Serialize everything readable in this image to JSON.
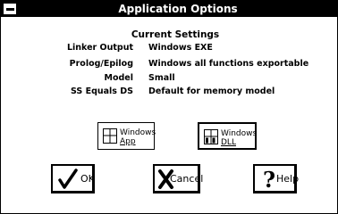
{
  "window": {
    "title": "Application Options"
  },
  "current_settings": {
    "heading": "Current Settings",
    "rows": [
      {
        "label": "Linker Output",
        "value": "Windows EXE"
      },
      {
        "label": "Prolog/Epilog",
        "value": "Windows all functions exportable"
      },
      {
        "label": "Model",
        "value": "Small"
      },
      {
        "label": "SS Equals DS",
        "value": "Default for memory model"
      }
    ]
  },
  "options": {
    "windows_app": {
      "line1": "Windows",
      "line2": "App"
    },
    "windows_dll": {
      "line1": "Windows",
      "line2": "DLL"
    }
  },
  "buttons": {
    "ok": "OK",
    "cancel": "Cancel",
    "help": "Help"
  }
}
